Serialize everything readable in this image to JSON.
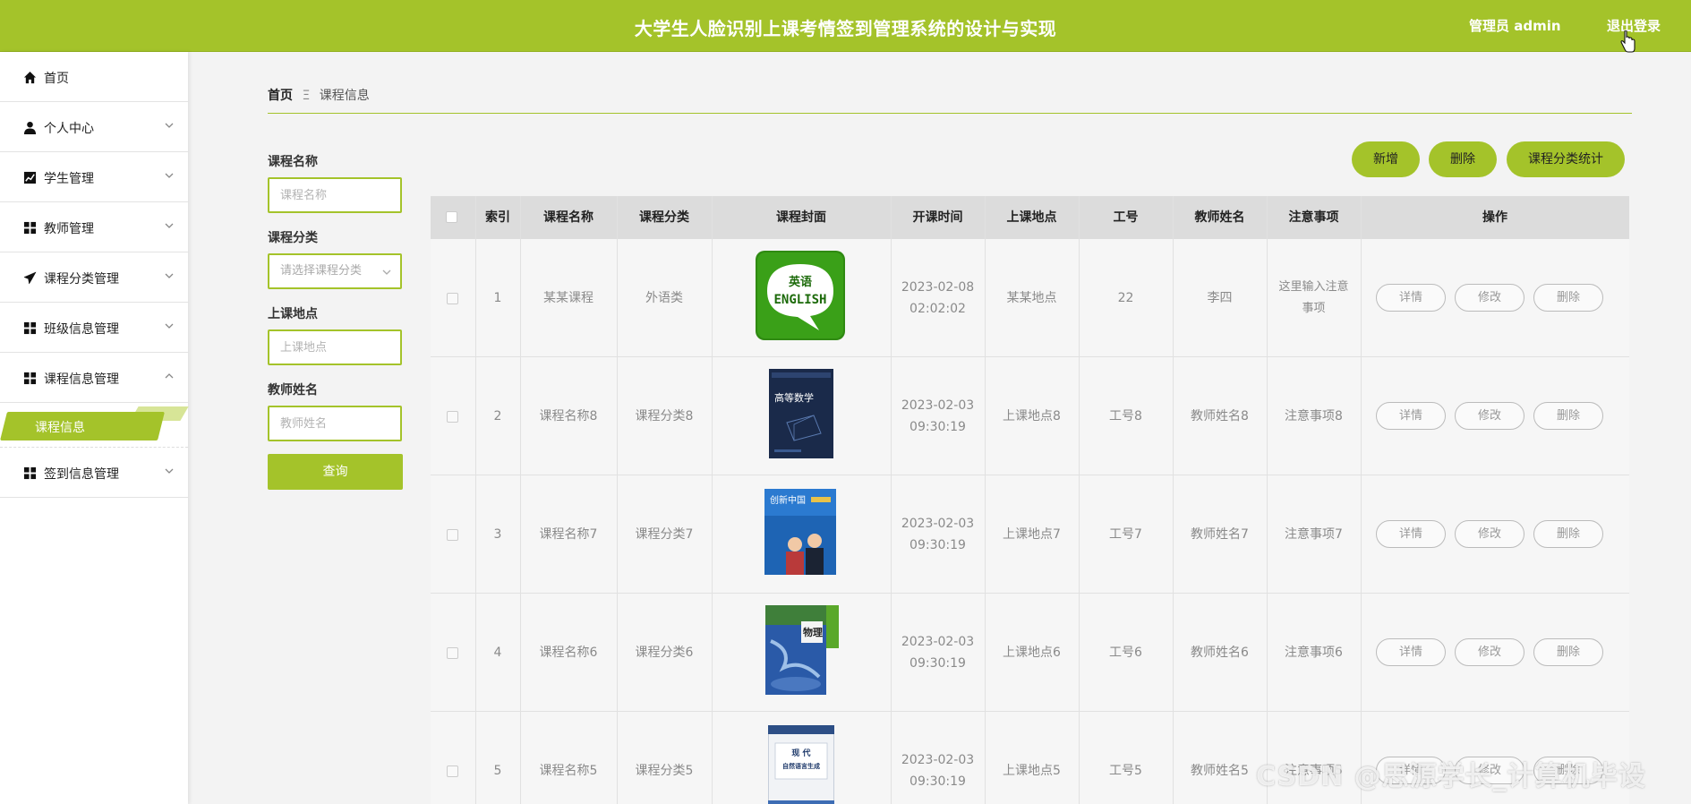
{
  "header": {
    "title": "大学生人脸识别上课考情签到管理系统的设计与实现",
    "user_label": "管理员 admin",
    "logout_label": "退出登录"
  },
  "sidebar": {
    "items": [
      {
        "label": "首页",
        "icon": "home-icon"
      },
      {
        "label": "个人中心",
        "icon": "user-icon"
      },
      {
        "label": "学生管理",
        "icon": "chart-icon"
      },
      {
        "label": "教师管理",
        "icon": "grid-icon"
      },
      {
        "label": "课程分类管理",
        "icon": "send-icon"
      },
      {
        "label": "班级信息管理",
        "icon": "grid-icon"
      },
      {
        "label": "课程信息管理",
        "icon": "grid-icon"
      },
      {
        "label": "签到信息管理",
        "icon": "grid-icon"
      }
    ],
    "active_sub": "课程信息"
  },
  "breadcrumb": {
    "home": "首页",
    "separator": "Ξ",
    "current": "课程信息"
  },
  "filters": {
    "course_name_label": "课程名称",
    "course_name_placeholder": "课程名称",
    "category_label": "课程分类",
    "category_placeholder": "请选择课程分类",
    "location_label": "上课地点",
    "location_placeholder": "上课地点",
    "teacher_label": "教师姓名",
    "teacher_placeholder": "教师姓名",
    "query_label": "查询"
  },
  "actions": {
    "add": "新增",
    "delete": "删除",
    "stats": "课程分类统计"
  },
  "table": {
    "headers": [
      "索引",
      "课程名称",
      "课程分类",
      "课程封面",
      "开课时间",
      "上课地点",
      "工号",
      "教师姓名",
      "注意事项",
      "操作"
    ],
    "row_buttons": {
      "detail": "详情",
      "edit": "修改",
      "delete": "删除"
    },
    "rows": [
      {
        "index": "1",
        "name": "某某课程",
        "category": "外语类",
        "cover": "english-cover",
        "date": "2023-02-08",
        "time": "02:02:02",
        "location": "某某地点",
        "job_no": "22",
        "teacher": "李四",
        "note1": "这里输入注意",
        "note2": "事项"
      },
      {
        "index": "2",
        "name": "课程名称8",
        "category": "课程分类8",
        "cover": "math-book-cover",
        "date": "2023-02-03",
        "time": "09:30:19",
        "location": "上课地点8",
        "job_no": "工号8",
        "teacher": "教师姓名8",
        "note1": "注意事项8",
        "note2": ""
      },
      {
        "index": "3",
        "name": "课程名称7",
        "category": "课程分类7",
        "cover": "china-book-cover",
        "date": "2023-02-03",
        "time": "09:30:19",
        "location": "上课地点7",
        "job_no": "工号7",
        "teacher": "教师姓名7",
        "note1": "注意事项7",
        "note2": ""
      },
      {
        "index": "4",
        "name": "课程名称6",
        "category": "课程分类6",
        "cover": "physics-book-cover",
        "date": "2023-02-03",
        "time": "09:30:19",
        "location": "上课地点6",
        "job_no": "工号6",
        "teacher": "教师姓名6",
        "note1": "注意事项6",
        "note2": ""
      },
      {
        "index": "5",
        "name": "课程名称5",
        "category": "课程分类5",
        "cover": "modern-book-cover",
        "date": "2023-02-03",
        "time": "09:30:19",
        "location": "上课地点5",
        "job_no": "工号5",
        "teacher": "教师姓名5",
        "note1": "注意事项5",
        "note2": ""
      }
    ]
  },
  "book_cover_text": {
    "english_top": "英语",
    "english_main": "ENGLISH",
    "math": "高等数学",
    "china": "创新中国",
    "physics": "物理",
    "modern1": "现 代",
    "modern2": "自然语言生成"
  },
  "watermark": "CSDN @思源学长_计算机毕设",
  "colors": {
    "accent": "#a4c32a",
    "background": "#f3f3f3"
  }
}
